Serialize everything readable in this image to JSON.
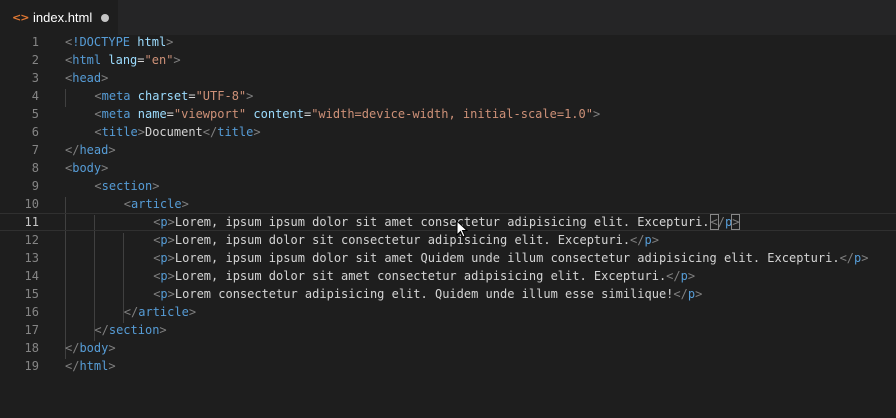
{
  "tab": {
    "icon": "<>",
    "icon_name": "html-file-icon",
    "filename": "index.html",
    "dirty_indicator": "modified-dot"
  },
  "editor": {
    "language": "html",
    "current_line": 11,
    "lines": [
      {
        "num": "1",
        "indent": 0,
        "tokens": [
          [
            "b",
            "<"
          ],
          [
            "t",
            "!DOCTYPE"
          ],
          [
            "x",
            " "
          ],
          [
            "a",
            "html"
          ],
          [
            "b",
            ">"
          ]
        ]
      },
      {
        "num": "2",
        "indent": 0,
        "tokens": [
          [
            "b",
            "<"
          ],
          [
            "t",
            "html"
          ],
          [
            "x",
            " "
          ],
          [
            "a",
            "lang"
          ],
          [
            "x",
            "="
          ],
          [
            "s",
            "\"en\""
          ],
          [
            "b",
            ">"
          ]
        ]
      },
      {
        "num": "3",
        "indent": 0,
        "tokens": [
          [
            "b",
            "<"
          ],
          [
            "t",
            "head"
          ],
          [
            "b",
            ">"
          ]
        ]
      },
      {
        "num": "4",
        "indent": 1,
        "tokens": [
          [
            "b",
            "<"
          ],
          [
            "t",
            "meta"
          ],
          [
            "x",
            " "
          ],
          [
            "a",
            "charset"
          ],
          [
            "x",
            "="
          ],
          [
            "s",
            "\"UTF-8\""
          ],
          [
            "b",
            ">"
          ]
        ]
      },
      {
        "num": "5",
        "indent": 1,
        "tokens": [
          [
            "b",
            "<"
          ],
          [
            "t",
            "meta"
          ],
          [
            "x",
            " "
          ],
          [
            "a",
            "name"
          ],
          [
            "x",
            "="
          ],
          [
            "s",
            "\"viewport\""
          ],
          [
            "x",
            " "
          ],
          [
            "a",
            "content"
          ],
          [
            "x",
            "="
          ],
          [
            "s",
            "\"width=device-width, initial-scale=1.0\""
          ],
          [
            "b",
            ">"
          ]
        ]
      },
      {
        "num": "6",
        "indent": 1,
        "tokens": [
          [
            "b",
            "<"
          ],
          [
            "t",
            "title"
          ],
          [
            "b",
            ">"
          ],
          [
            "x",
            "Document"
          ],
          [
            "b",
            "</"
          ],
          [
            "t",
            "title"
          ],
          [
            "b",
            ">"
          ]
        ]
      },
      {
        "num": "7",
        "indent": 0,
        "tokens": [
          [
            "b",
            "</"
          ],
          [
            "t",
            "head"
          ],
          [
            "b",
            ">"
          ]
        ]
      },
      {
        "num": "8",
        "indent": 0,
        "tokens": [
          [
            "b",
            "<"
          ],
          [
            "t",
            "body"
          ],
          [
            "b",
            ">"
          ]
        ]
      },
      {
        "num": "9",
        "indent": 1,
        "tokens": [
          [
            "b",
            "<"
          ],
          [
            "t",
            "section"
          ],
          [
            "b",
            ">"
          ]
        ]
      },
      {
        "num": "10",
        "indent": 2,
        "tokens": [
          [
            "b",
            "<"
          ],
          [
            "t",
            "article"
          ],
          [
            "b",
            ">"
          ]
        ]
      },
      {
        "num": "11",
        "indent": 3,
        "tokens": [
          [
            "b",
            "<"
          ],
          [
            "t",
            "p"
          ],
          [
            "b",
            ">"
          ],
          [
            "x",
            "Lorem, ipsum ipsum dolor sit amet consectetur adipisicing elit. Excepturi."
          ],
          [
            "caret",
            ""
          ],
          [
            "box",
            "<"
          ],
          [
            "b",
            "/"
          ],
          [
            "t",
            "p"
          ],
          [
            "box",
            ">"
          ]
        ]
      },
      {
        "num": "12",
        "indent": 3,
        "tokens": [
          [
            "b",
            "<"
          ],
          [
            "t",
            "p"
          ],
          [
            "b",
            ">"
          ],
          [
            "x",
            "Lorem, ipsum dolor sit consectetur adipisicing elit. Excepturi."
          ],
          [
            "b",
            "</"
          ],
          [
            "t",
            "p"
          ],
          [
            "b",
            ">"
          ]
        ]
      },
      {
        "num": "13",
        "indent": 3,
        "tokens": [
          [
            "b",
            "<"
          ],
          [
            "t",
            "p"
          ],
          [
            "b",
            ">"
          ],
          [
            "x",
            "Lorem, ipsum ipsum dolor sit amet Quidem unde illum consectetur adipisicing elit. Excepturi."
          ],
          [
            "b",
            "</"
          ],
          [
            "t",
            "p"
          ],
          [
            "b",
            ">"
          ]
        ]
      },
      {
        "num": "14",
        "indent": 3,
        "tokens": [
          [
            "b",
            "<"
          ],
          [
            "t",
            "p"
          ],
          [
            "b",
            ">"
          ],
          [
            "x",
            "Lorem, ipsum dolor sit amet consectetur adipisicing elit. Excepturi."
          ],
          [
            "b",
            "</"
          ],
          [
            "t",
            "p"
          ],
          [
            "b",
            ">"
          ]
        ]
      },
      {
        "num": "15",
        "indent": 3,
        "tokens": [
          [
            "b",
            "<"
          ],
          [
            "t",
            "p"
          ],
          [
            "b",
            ">"
          ],
          [
            "x",
            "Lorem consectetur adipisicing elit. Quidem unde illum esse similique!"
          ],
          [
            "b",
            "</"
          ],
          [
            "t",
            "p"
          ],
          [
            "b",
            ">"
          ]
        ]
      },
      {
        "num": "16",
        "indent": 2,
        "tokens": [
          [
            "b",
            "</"
          ],
          [
            "t",
            "article"
          ],
          [
            "b",
            ">"
          ]
        ]
      },
      {
        "num": "17",
        "indent": 1,
        "tokens": [
          [
            "b",
            "</"
          ],
          [
            "t",
            "section"
          ],
          [
            "b",
            ">"
          ]
        ]
      },
      {
        "num": "18",
        "indent": 0,
        "tokens": [
          [
            "b",
            "</"
          ],
          [
            "t",
            "body"
          ],
          [
            "b",
            ">"
          ]
        ]
      },
      {
        "num": "19",
        "indent": 0,
        "tokens": [
          [
            "b",
            "</"
          ],
          [
            "t",
            "html"
          ],
          [
            "b",
            ">"
          ]
        ]
      }
    ]
  },
  "colors": {
    "background": "#1e1e1e",
    "tag": "#569cd6",
    "attribute": "#9cdcfe",
    "string": "#ce9178",
    "text": "#d4d4d4",
    "bracket": "#808080",
    "line_number": "#858585",
    "html_icon": "#e37933"
  },
  "mouse_pointer_icon": "text-cursor-arrow-icon"
}
